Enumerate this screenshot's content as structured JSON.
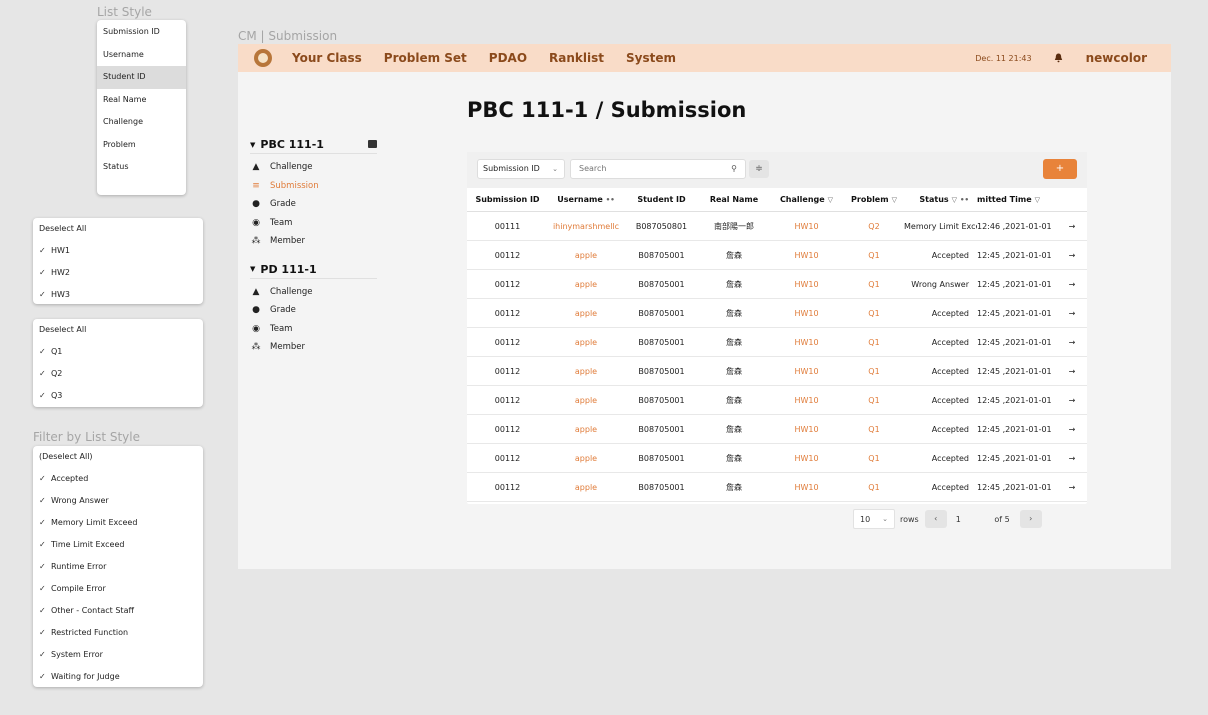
{
  "left": {
    "list_style_caption": "List Style",
    "list_style_items": [
      "Submission ID",
      "Username",
      "Student ID",
      "Real Name",
      "Challenge",
      "Problem",
      "Status"
    ],
    "list_style_selected": "Student ID",
    "challenge_filter": {
      "deselect": "Deselect All",
      "items": [
        "HW1",
        "HW2",
        "HW3"
      ]
    },
    "problem_filter": {
      "deselect": "Deselect All",
      "items": [
        "Q1",
        "Q2",
        "Q3"
      ]
    },
    "status_filter_caption": "Filter by List Style",
    "status_filter": {
      "deselect": "(Deselect All)",
      "items": [
        "Accepted",
        "Wrong Answer",
        "Memory Limit Exceed",
        "Time Limit Exceed",
        "Runtime Error",
        "Compile Error",
        "Other - Contact Staff",
        "Restricted Function",
        "System Error",
        "Waiting for Judge"
      ]
    }
  },
  "frame_caption": "CM | Submission",
  "navbar": {
    "items": [
      "Your Class",
      "Problem Set",
      "PDAO",
      "Ranklist",
      "System"
    ],
    "date": "Dec. 11 21:43",
    "user": "newcolor"
  },
  "page_title": "PBC 111-1 / Submission",
  "sidenav": {
    "course1": {
      "title": "PBC 111-1",
      "items": [
        "Challenge",
        "Submission",
        "Grade",
        "Team",
        "Member"
      ],
      "active": "Submission"
    },
    "course2": {
      "title": "PD 111-1",
      "items": [
        "Challenge",
        "Grade",
        "Team",
        "Member"
      ]
    }
  },
  "toolbar": {
    "select_value": "Submission ID",
    "search_placeholder": "Search",
    "add_label": "+"
  },
  "table": {
    "headers": [
      "Submission ID",
      "Username",
      "Student ID",
      "Real Name",
      "Challenge",
      "Problem",
      "Status",
      "mitted Time"
    ],
    "rows": [
      [
        "00111",
        "ihinymarshmellc",
        "B087050801",
        "南部陽一郎",
        "HW10",
        "Q2",
        "Memory Limit Exce",
        "2021-01-01, 12:46"
      ],
      [
        "00112",
        "apple",
        "B08705001",
        "詹森",
        "HW10",
        "Q1",
        "Accepted",
        "2021-01-01, 12:45"
      ],
      [
        "00112",
        "apple",
        "B08705001",
        "詹森",
        "HW10",
        "Q1",
        "Wrong Answer",
        "2021-01-01, 12:45"
      ],
      [
        "00112",
        "apple",
        "B08705001",
        "詹森",
        "HW10",
        "Q1",
        "Accepted",
        "2021-01-01, 12:45"
      ],
      [
        "00112",
        "apple",
        "B08705001",
        "詹森",
        "HW10",
        "Q1",
        "Accepted",
        "2021-01-01, 12:45"
      ],
      [
        "00112",
        "apple",
        "B08705001",
        "詹森",
        "HW10",
        "Q1",
        "Accepted",
        "2021-01-01, 12:45"
      ],
      [
        "00112",
        "apple",
        "B08705001",
        "詹森",
        "HW10",
        "Q1",
        "Accepted",
        "2021-01-01, 12:45"
      ],
      [
        "00112",
        "apple",
        "B08705001",
        "詹森",
        "HW10",
        "Q1",
        "Accepted",
        "2021-01-01, 12:45"
      ],
      [
        "00112",
        "apple",
        "B08705001",
        "詹森",
        "HW10",
        "Q1",
        "Accepted",
        "2021-01-01, 12:45"
      ],
      [
        "00112",
        "apple",
        "B08705001",
        "詹森",
        "HW10",
        "Q1",
        "Accepted",
        "2021-01-01, 12:45"
      ]
    ]
  },
  "pager": {
    "rows_value": "10",
    "rows_label": "rows",
    "page": "1",
    "of_label": "of 5"
  },
  "colors": {
    "accent": "#e07c3a",
    "navbar_bg": "#f9dcc8",
    "nav_text": "#8b4a1c"
  },
  "icons": {
    "row_action": "arrow-right-icon",
    "header_sort": "filter-icon",
    "header_expand": "expand-icon",
    "bell": "bell-icon"
  }
}
